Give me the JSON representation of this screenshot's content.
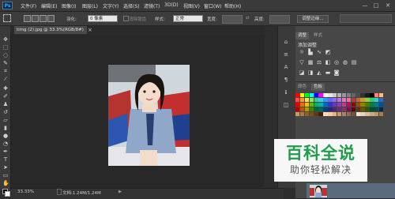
{
  "app": {
    "logo": "Ps"
  },
  "menu": [
    "文件(F)",
    "编辑(E)",
    "图像(I)",
    "图层(L)",
    "文字(Y)",
    "选择(S)",
    "滤镜(T)",
    "3D(D)",
    "视图(V)",
    "窗口(W)",
    "帮助(H)"
  ],
  "window_controls": [
    "—",
    "□",
    "✕"
  ],
  "options_bar": {
    "feather_label": "羽化:",
    "feather_value": "0 像素",
    "antialias_label": "消除锯齿",
    "style_label": "样式:",
    "style_value": "正常",
    "width_label": "宽度:",
    "height_label": "高度:",
    "refine_edge_button": "调整边缘..."
  },
  "document_tab": {
    "label": "timg (2).jpg @ 33.3%(RGB/8#)",
    "close": "×"
  },
  "status_bar": {
    "zoom": "33.33%",
    "doc_info": "文档:1.24M/1.24M"
  },
  "panel": {
    "tabs_top": [
      "调整",
      "样式"
    ],
    "adjust_title": "添加调整",
    "tabs_mid": [
      "颜色",
      "色板"
    ]
  },
  "colors": {
    "accent_green": "#1f9e4a",
    "swatches": [
      "#ff0000",
      "#ffff00",
      "#00ff00",
      "#00ffff",
      "#0000ff",
      "#ff00ff",
      "#ffffff",
      "#e6e6e6",
      "#cccccc",
      "#b3b3b3",
      "#999999",
      "#808080",
      "#666666",
      "#4d4d4d",
      "#333333",
      "#1a1a1a",
      "#000000",
      "#ff8080",
      "#ffbf80",
      "#ff4d4d",
      "#ff9933",
      "#ffe066",
      "#99e64d",
      "#33cc99",
      "#33ccff",
      "#3399ff",
      "#6666ff",
      "#9966ff",
      "#cc66ff",
      "#ff66cc",
      "#ff6699",
      "#cc3333",
      "#cc6633",
      "#cc9933",
      "#99cc33",
      "#33cc66",
      "#33cccc",
      "#3366cc",
      "#e60000",
      "#e67300",
      "#e6c300",
      "#66b300",
      "#00b366",
      "#00b3b3",
      "#0066cc",
      "#3333cc",
      "#6633cc",
      "#9933cc",
      "#cc3399",
      "#cc0066",
      "#990000",
      "#994d00",
      "#998000",
      "#4d8000",
      "#008040",
      "#008080",
      "#004d99",
      "#b30000",
      "#b35900",
      "#b39800",
      "#408000",
      "#006633",
      "#006666",
      "#003d7a",
      "#26267a",
      "#4d267a",
      "#73267a",
      "#992673",
      "#99004d",
      "#660000",
      "#663300",
      "#665500",
      "#335500",
      "#004d26",
      "#004d4d",
      "#00264d",
      "#c69c6d",
      "#a67c52",
      "#8c6239",
      "#754c24",
      "#603813",
      "#42210b",
      "#ffd9b3",
      "#ffcc99",
      "#e6b380",
      "#cc9966",
      "#b38059",
      "#99664d",
      "#804d33",
      "#f2e6d9",
      "#e6d2bf",
      "#d9bf99",
      "#ccab80",
      "#bf9966",
      "#a6804d"
    ]
  },
  "watermark": {
    "title": "百科全说",
    "subtitle": "助你轻松解决"
  },
  "icons": {
    "tools": [
      "move-icon",
      "marquee-icon",
      "lasso-icon",
      "quick-select-icon",
      "crop-icon",
      "eyedropper-icon",
      "healing-icon",
      "brush-icon",
      "stamp-icon",
      "history-brush-icon",
      "eraser-icon",
      "gradient-icon",
      "blur-icon",
      "dodge-icon",
      "pen-icon",
      "type-icon",
      "path-select-icon",
      "shape-icon",
      "hand-icon",
      "zoom-icon"
    ]
  }
}
